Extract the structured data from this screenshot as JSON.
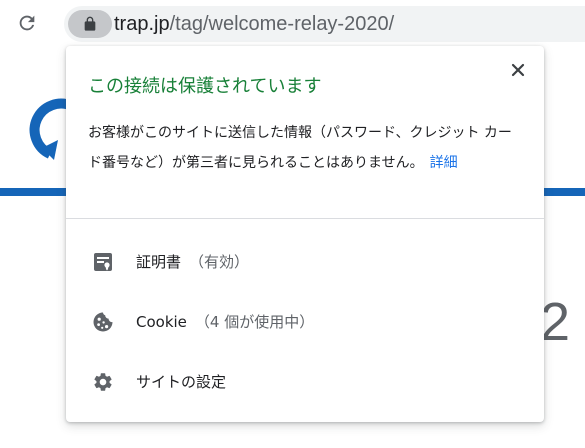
{
  "toolbar": {
    "url_host": "trap.jp",
    "url_path": "/tag/welcome-relay-2020/"
  },
  "page": {
    "peek_text": "2"
  },
  "bubble": {
    "title": "この接続は保護されています",
    "description": "お客様がこのサイトに送信した情報（パスワード、クレジット カード番号など）が第三者に見られることはありません。",
    "details_link": "詳細",
    "rows": [
      {
        "label": "証明書",
        "status": "（有効）"
      },
      {
        "label": "Cookie",
        "status": "（4 個が使用中）"
      },
      {
        "label": "サイトの設定",
        "status": ""
      }
    ]
  },
  "colors": {
    "title_green": "#188038",
    "link_blue": "#1a73e8",
    "stripe_blue": "#1565b8",
    "icon_grey": "#5f6368"
  }
}
